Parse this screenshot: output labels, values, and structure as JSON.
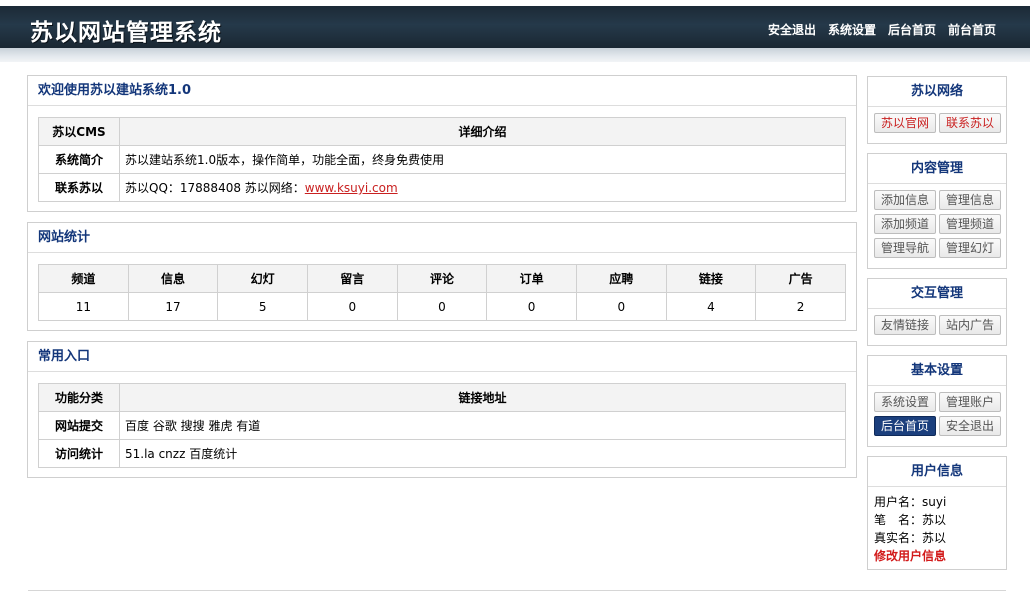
{
  "app": {
    "title": "苏以网站管理系统",
    "topnav": [
      "安全退出",
      "系统设置",
      "后台首页",
      "前台首页"
    ]
  },
  "welcome": {
    "title": "欢迎使用苏以建站系统1.0",
    "headers": [
      "苏以CMS",
      "详细介绍"
    ],
    "rows": [
      {
        "label": "系统简介",
        "value": "苏以建站系统1.0版本，操作简单，功能全面，终身免费使用"
      },
      {
        "label": "联系苏以",
        "value": "苏以QQ：17888408 苏以网络：",
        "link": "www.ksuyi.com"
      }
    ]
  },
  "stats": {
    "title": "网站统计",
    "headers": [
      "频道",
      "信息",
      "幻灯",
      "留言",
      "评论",
      "订单",
      "应聘",
      "链接",
      "广告"
    ],
    "values": [
      "11",
      "17",
      "5",
      "0",
      "0",
      "0",
      "0",
      "4",
      "2"
    ]
  },
  "entries": {
    "title": "常用入口",
    "headers": [
      "功能分类",
      "链接地址"
    ],
    "rows": [
      {
        "label": "网站提交",
        "value": "百度 谷歌 搜搜 雅虎 有道"
      },
      {
        "label": "访问统计",
        "value": "51.la cnzz 百度统计"
      }
    ]
  },
  "sidebar": {
    "network": {
      "title": "苏以网络",
      "buttons": [
        "苏以官网",
        "联系苏以"
      ]
    },
    "content": {
      "title": "内容管理",
      "buttons": [
        "添加信息",
        "管理信息",
        "添加频道",
        "管理频道",
        "管理导航",
        "管理幻灯"
      ]
    },
    "interaction": {
      "title": "交互管理",
      "buttons": [
        "友情链接",
        "站内广告"
      ]
    },
    "basic": {
      "title": "基本设置",
      "buttons": [
        "系统设置",
        "管理账户",
        "后台首页",
        "安全退出"
      ],
      "active": "后台首页"
    },
    "user": {
      "title": "用户信息",
      "username": "用户名：suyi",
      "nickname": "笔　名：苏以",
      "realname": "真实名：苏以",
      "edit": "修改用户信息"
    }
  },
  "colors": {
    "header_dark": "#1c2a36",
    "title_blue": "#13367a",
    "link_red": "#c92020",
    "active_btn": "#1b3f7d"
  }
}
